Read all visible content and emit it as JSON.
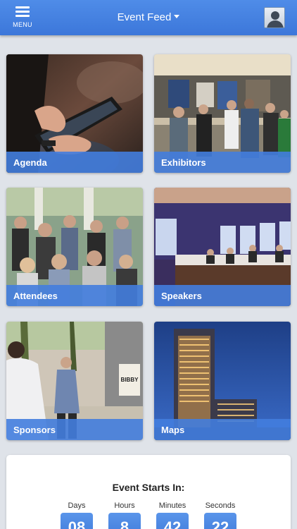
{
  "header": {
    "menu_label": "MENU",
    "title": "Event Feed"
  },
  "tiles": [
    {
      "label": "Agenda"
    },
    {
      "label": "Exhibitors"
    },
    {
      "label": "Attendees"
    },
    {
      "label": "Speakers"
    },
    {
      "label": "Sponsors"
    },
    {
      "label": "Maps"
    }
  ],
  "countdown": {
    "title": "Event Starts In:",
    "units": [
      {
        "label": "Days",
        "value": "08"
      },
      {
        "label": "Hours",
        "value": "8"
      },
      {
        "label": "Minutes",
        "value": "42"
      },
      {
        "label": "Seconds",
        "value": "22"
      }
    ]
  },
  "signs": {
    "bibby": "BIBBY"
  },
  "colors": {
    "header_blue": "#3c77da",
    "label_bar_blue": "#427dde",
    "background": "#dfe3e9"
  }
}
